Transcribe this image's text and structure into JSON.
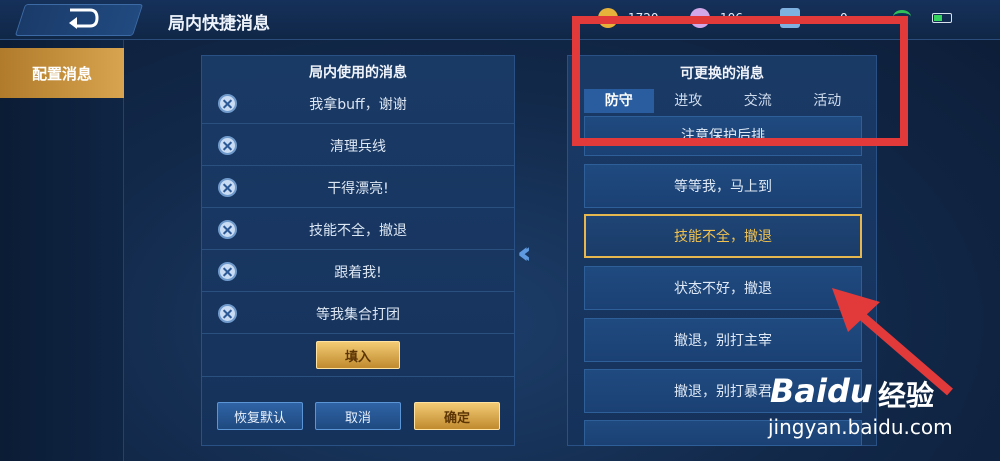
{
  "header": {
    "title": "局内快捷消息",
    "resources": [
      {
        "icon": "gold-coin-icon",
        "value": "1720",
        "color": "#e6b23a"
      },
      {
        "icon": "diamond-icon",
        "value": "106",
        "color": "#d2a8e8"
      },
      {
        "icon": "ticket-icon",
        "value": "0",
        "color": "#7fb1e0"
      }
    ]
  },
  "sidebar": {
    "items": [
      {
        "label": "配置消息",
        "active": true
      }
    ]
  },
  "left_panel": {
    "title": "局内使用的消息",
    "messages": [
      "我拿buff，谢谢",
      "清理兵线",
      "干得漂亮!",
      "技能不全，撤退",
      "跟着我!",
      "等我集合打团"
    ],
    "fill_button": "填入",
    "buttons": {
      "reset": "恢复默认",
      "cancel": "取消",
      "confirm": "确定"
    }
  },
  "right_panel": {
    "title": "可更换的消息",
    "tabs": [
      {
        "label": "防守",
        "active": true
      },
      {
        "label": "进攻",
        "active": false
      },
      {
        "label": "交流",
        "active": false
      },
      {
        "label": "活动",
        "active": false
      }
    ],
    "options": [
      "注意保护后排",
      "等等我，马上到",
      "技能不全，撤退",
      "状态不好，撤退",
      "撤退，别打主宰",
      "撤退，别打暴君"
    ],
    "selected_index": 2
  },
  "watermark": {
    "brand": "Baidu",
    "brand_cn": "经验",
    "url": "jingyan.baidu.com"
  },
  "colors": {
    "accent_gold": "#e6b64f",
    "highlight_red": "#e23a3a",
    "panel_blue": "#1a3a66"
  }
}
